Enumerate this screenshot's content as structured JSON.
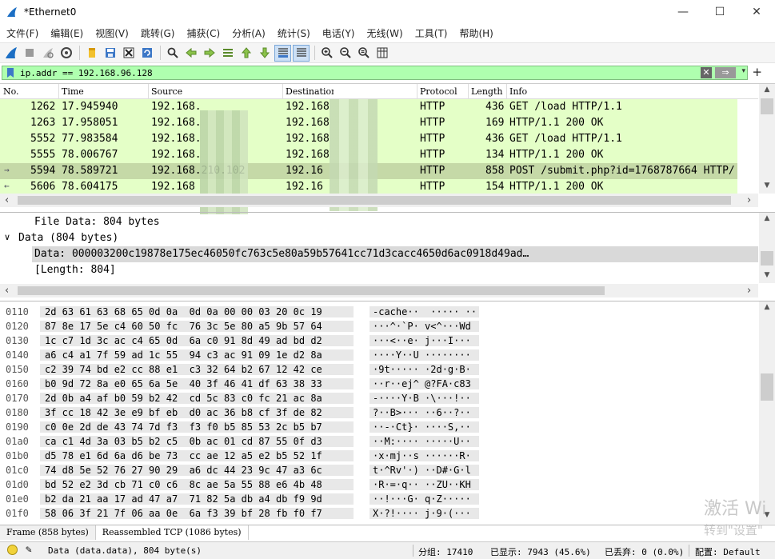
{
  "window": {
    "title": "*Ethernet0",
    "minimize": "—",
    "maximize": "☐",
    "close": "✕"
  },
  "menu": [
    "文件(F)",
    "编辑(E)",
    "视图(V)",
    "跳转(G)",
    "捕获(C)",
    "分析(A)",
    "统计(S)",
    "电话(Y)",
    "无线(W)",
    "工具(T)",
    "帮助(H)"
  ],
  "filter": {
    "value": "ip.addr == 192.168.96.128",
    "apply_glyph": "⇒",
    "clear_glyph": "✕",
    "dropdown_glyph": "▾",
    "add_glyph": "+"
  },
  "packet_list": {
    "columns": [
      "No.",
      "Time",
      "Source",
      "Destination",
      "Protocol",
      "Length",
      "Info"
    ],
    "rows": [
      {
        "no": "1262",
        "time": "17.945940",
        "source": "192.168.",
        "destination": "192.168",
        "protocol": "HTTP",
        "length": "436",
        "info": "GET /load HTTP/1.1",
        "mark": "",
        "selected": false
      },
      {
        "no": "1263",
        "time": "17.958051",
        "source": "192.168.",
        "destination": "192.168",
        "protocol": "HTTP",
        "length": "169",
        "info": "HTTP/1.1 200 OK",
        "mark": "",
        "selected": false
      },
      {
        "no": "5552",
        "time": "77.983584",
        "source": "192.168.",
        "destination": "192.168",
        "protocol": "HTTP",
        "length": "436",
        "info": "GET /load HTTP/1.1",
        "mark": "",
        "selected": false
      },
      {
        "no": "5555",
        "time": "78.006767",
        "source": "192.168.",
        "destination": "192.168",
        "protocol": "HTTP",
        "length": "134",
        "info": "HTTP/1.1 200 OK",
        "mark": "",
        "selected": false
      },
      {
        "no": "5594",
        "time": "78.589721",
        "source": "192.168.210.102",
        "destination": "192.16",
        "protocol": "HTTP",
        "length": "858",
        "info": "POST /submit.php?id=1768787664 HTTP/",
        "mark": "→",
        "selected": true
      },
      {
        "no": "5606",
        "time": "78.604175",
        "source": "192.168",
        "destination": "192.16",
        "protocol": "HTTP",
        "length": "154",
        "info": "HTTP/1.1 200 OK",
        "mark": "←",
        "selected": false
      }
    ]
  },
  "details": {
    "rows": [
      {
        "text": "File Data: 804 bytes",
        "indent": 0,
        "expander": "",
        "selected": false
      },
      {
        "text": "Data (804 bytes)",
        "indent": 0,
        "expander": "∨",
        "selected": false
      },
      {
        "text": "Data: 000003200c19878e175ec46050fc763c5e80a59b57641cc71d3cacc4650d6ac0918d49ad…",
        "indent": 1,
        "expander": "",
        "selected": true
      },
      {
        "text": "[Length: 804]",
        "indent": 1,
        "expander": "",
        "selected": false
      }
    ]
  },
  "bytes": {
    "rows": [
      {
        "offset": "0110",
        "hex": "2d 63 61 63 68 65 0d 0a  0d 0a 00 00 03 20 0c 19",
        "ascii": "-cache··  ····· ··"
      },
      {
        "offset": "0120",
        "hex": "87 8e 17 5e c4 60 50 fc  76 3c 5e 80 a5 9b 57 64",
        "ascii": "···^·`P· v<^···Wd"
      },
      {
        "offset": "0130",
        "hex": "1c c7 1d 3c ac c4 65 0d  6a c0 91 8d 49 ad bd d2",
        "ascii": "···<··e· j···I···"
      },
      {
        "offset": "0140",
        "hex": "a6 c4 a1 7f 59 ad 1c 55  94 c3 ac 91 09 1e d2 8a",
        "ascii": "····Y··U ········"
      },
      {
        "offset": "0150",
        "hex": "c2 39 74 bd e2 cc 88 e1  c3 32 64 b2 67 12 42 ce",
        "ascii": "·9t····· ·2d·g·B·"
      },
      {
        "offset": "0160",
        "hex": "b0 9d 72 8a e0 65 6a 5e  40 3f 46 41 df 63 38 33",
        "ascii": "··r··ej^ @?FA·c83"
      },
      {
        "offset": "0170",
        "hex": "2d 0b a4 af b0 59 b2 42  cd 5c 83 c0 fc 21 ac 8a",
        "ascii": "-····Y·B ·\\···!··"
      },
      {
        "offset": "0180",
        "hex": "3f cc 18 42 3e e9 bf eb  d0 ac 36 b8 cf 3f de 82",
        "ascii": "?··B>··· ··6··?··"
      },
      {
        "offset": "0190",
        "hex": "c0 0e 2d de 43 74 7d f3  f3 f0 b5 85 53 2c b5 b7",
        "ascii": "··-·Ct}· ····S,··"
      },
      {
        "offset": "01a0",
        "hex": "ca c1 4d 3a 03 b5 b2 c5  0b ac 01 cd 87 55 0f d3",
        "ascii": "··M:···· ·····U··"
      },
      {
        "offset": "01b0",
        "hex": "d5 78 e1 6d 6a d6 be 73  cc ae 12 a5 e2 b5 52 1f",
        "ascii": "·x·mj··s ······R·"
      },
      {
        "offset": "01c0",
        "hex": "74 d8 5e 52 76 27 90 29  a6 dc 44 23 9c 47 a3 6c",
        "ascii": "t·^Rv'·) ··D#·G·l"
      },
      {
        "offset": "01d0",
        "hex": "bd 52 e2 3d cb 71 c0 c6  8c ae 5a 55 88 e6 4b 48",
        "ascii": "·R·=·q·· ··ZU··KH"
      },
      {
        "offset": "01e0",
        "hex": "b2 da 21 aa 17 ad 47 a7  71 82 5a db a4 db f9 9d",
        "ascii": "··!···G· q·Z·····"
      },
      {
        "offset": "01f0",
        "hex": "58 06 3f 21 7f 06 aa 0e  6a f3 39 bf 28 fb f0 f7",
        "ascii": "X·?!···· j·9·(···"
      }
    ]
  },
  "bottom_tabs": [
    "Frame (858 bytes)",
    "Reassembled TCP (1086 bytes)"
  ],
  "status": {
    "expert": "Data (data.data), 804 byte(s)",
    "packets": "分组: 17410",
    "displayed": "已显示: 7943 (45.6%)",
    "dropped": "已丢弃: 0 (0.0%)",
    "profile": "配置: Default"
  },
  "watermark": {
    "line1": "激活 Wi",
    "line2": "转到\"设置\""
  },
  "colors": {
    "filter_ok": "#afffaf",
    "http_row": "#e4ffc7",
    "http_row_selected": "#c5d9a7",
    "brand_blue": "#1c6fc4"
  }
}
